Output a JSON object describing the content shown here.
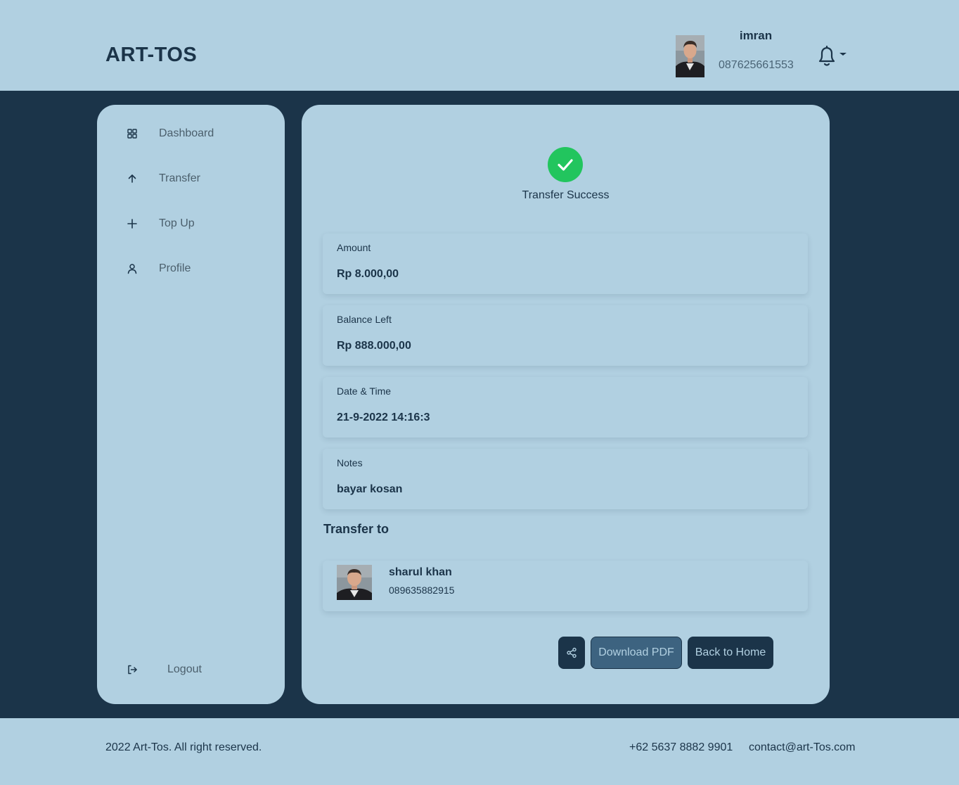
{
  "header": {
    "brand": "ART-TOS",
    "user": {
      "name": "imran",
      "phone": "087625661553",
      "avatar": "user-avatar"
    },
    "icons": {
      "notifications": "bell-icon",
      "dropdown": "caret-down-icon"
    }
  },
  "sidebar": {
    "items": [
      {
        "label": "Dashboard",
        "icon": "grid-icon"
      },
      {
        "label": "Transfer",
        "icon": "arrow-up-icon"
      },
      {
        "label": "Top Up",
        "icon": "plus-icon"
      },
      {
        "label": "Profile",
        "icon": "user-icon"
      }
    ],
    "logout": {
      "label": "Logout",
      "icon": "logout-icon"
    }
  },
  "main": {
    "status": {
      "text": "Transfer Success",
      "icon": "check-circle-icon",
      "color": "#22c55e"
    },
    "details": [
      {
        "label": "Amount",
        "value": "Rp 8.000,00"
      },
      {
        "label": "Balance Left",
        "value": "Rp 888.000,00"
      },
      {
        "label": "Date & Time",
        "value": "21-9-2022 14:16:3"
      },
      {
        "label": "Notes",
        "value": "bayar kosan"
      }
    ],
    "transfer_to": {
      "heading": "Transfer to",
      "recipient": {
        "name": "sharul khan",
        "phone": "089635882915",
        "avatar": "recipient-avatar"
      }
    },
    "actions": {
      "share_icon": "share-icon",
      "download_label": "Download PDF",
      "home_label": "Back to Home"
    }
  },
  "footer": {
    "copyright": "2022 Art-Tos. All right reserved.",
    "phone": "+62 5637 8882 9901",
    "email": "contact@art-Tos.com"
  },
  "colors": {
    "primary": "#1b3449",
    "surface": "#b1d0e1",
    "success": "#22c55e",
    "secondary_button": "#3d6380"
  }
}
